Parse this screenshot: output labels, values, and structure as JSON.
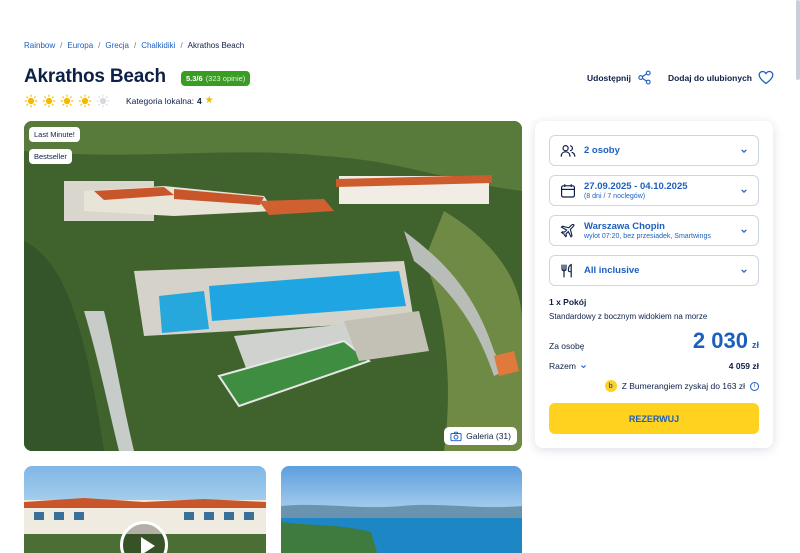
{
  "breadcrumb": {
    "items": [
      "Rainbow",
      "Europa",
      "Grecja",
      "Chalkidiki"
    ],
    "current": "Akrathos Beach"
  },
  "hotel": {
    "name": "Akrathos Beach",
    "rating_score": "5.3/6",
    "rating_count": "(323 opinie)",
    "suns": 4,
    "suns_max": 5,
    "local_category_label": "Kategoria lokalna:",
    "local_category_value": "4"
  },
  "actions": {
    "share": "Udostępnij",
    "favorite": "Dodaj do ulubionych"
  },
  "photo": {
    "badges": [
      "Last Minute!",
      "Bestseller"
    ],
    "gallery_label": "Galeria (31)"
  },
  "booking": {
    "persons": "2 osoby",
    "dates": "27.09.2025 - 04.10.2025",
    "dates_sub": "(8 dni / 7 noclegów)",
    "airport": "Warszawa Chopin",
    "airport_sub": "wylot 07:20, bez przesiadek, Smartwings",
    "board": "All inclusive",
    "rooms": "1 x Pokój",
    "room_desc": "Standardowy z bocznym widokiem na morze",
    "per_person_label": "Za osobę",
    "per_person_price": "2 030",
    "currency": "zł",
    "total_label": "Razem",
    "total_value": "4 059 zł",
    "bumerang_text": "Z Bumerangiem zyskaj do 163 zł",
    "book_button": "REZERWUJ"
  },
  "colors": {
    "brand_blue": "#1d5fbf",
    "accent_yellow": "#ffd21f",
    "rating_green": "#3a9d23",
    "text_dark": "#0d2048"
  }
}
